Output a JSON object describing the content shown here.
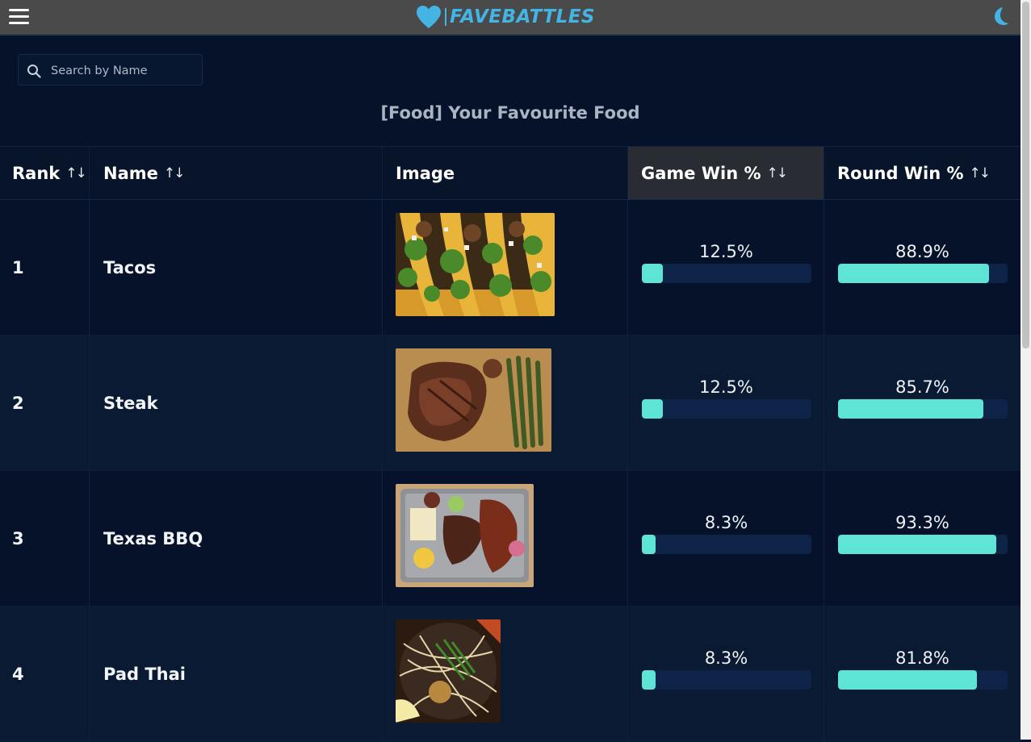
{
  "header": {
    "logo_text": "FAVEBATTLES",
    "accent": "#44b4e4",
    "menu_icon": "hamburger-menu-icon",
    "theme_icon": "moon-icon"
  },
  "search": {
    "placeholder": "Search by Name",
    "value": ""
  },
  "page_title": "[Food] Your Favourite Food",
  "table": {
    "columns": [
      {
        "label": "Rank",
        "sortable": true
      },
      {
        "label": "Name",
        "sortable": true
      },
      {
        "label": "Image",
        "sortable": false
      },
      {
        "label": "Game Win %",
        "sortable": true,
        "active": true
      },
      {
        "label": "Round Win %",
        "sortable": true
      }
    ],
    "sort_icon": "↑↓",
    "rows": [
      {
        "rank": "1",
        "name": "Tacos",
        "game_win": "12.5%",
        "game_win_value": 12.5,
        "round_win": "88.9%",
        "round_win_value": 88.9
      },
      {
        "rank": "2",
        "name": "Steak",
        "game_win": "12.5%",
        "game_win_value": 12.5,
        "round_win": "85.7%",
        "round_win_value": 85.7
      },
      {
        "rank": "3",
        "name": "Texas BBQ",
        "game_win": "8.3%",
        "game_win_value": 8.3,
        "round_win": "93.3%",
        "round_win_value": 93.3
      },
      {
        "rank": "4",
        "name": "Pad Thai",
        "game_win": "8.3%",
        "game_win_value": 8.3,
        "round_win": "81.8%",
        "round_win_value": 81.8
      }
    ]
  },
  "colors": {
    "background": "#06122a",
    "row_alt": "#0b1a33",
    "bar_fill": "#5de4d4",
    "bar_track": "#0d2347",
    "active_header": "#2a2c33"
  }
}
